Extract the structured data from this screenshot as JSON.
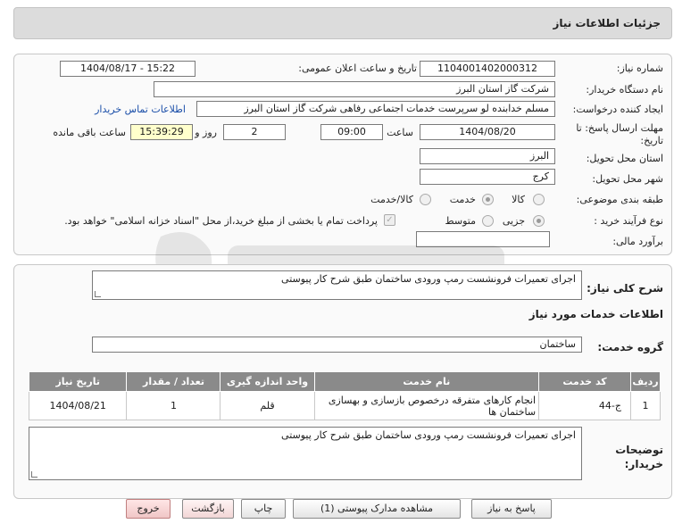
{
  "header": {
    "title": "جزئیات اطلاعات نیاز"
  },
  "form": {
    "need_number_label": "شماره نیاز:",
    "need_number": "1104001402000312",
    "announce_label": "تاریخ و ساعت اعلان عمومی:",
    "announce_value": "1404/08/17 - 15:22",
    "buyer_org_label": "نام دستگاه خریدار:",
    "buyer_org": "شرکت گاز استان البرز",
    "creator_label": "ایجاد کننده درخواست:",
    "creator": "مسلم خدابنده لو سرپرست خدمات اجتماعی رفاهی شرکت گاز استان البرز",
    "contact_link": "اطلاعات تماس خریدار",
    "deadline_label": "مهلت ارسال پاسخ: تا تاریخ:",
    "deadline_date": "1404/08/20",
    "time_label": "ساعت",
    "deadline_time": "09:00",
    "days_value": "2",
    "days_label": "روز و",
    "remaining_time": "15:39:29",
    "remaining_label": "ساعت باقی مانده",
    "province_label": "استان محل تحویل:",
    "province": "البرز",
    "city_label": "شهر محل تحویل:",
    "city": "کرج",
    "category_label": "طبقه بندی موضوعی:",
    "category_options": [
      "کالا",
      "خدمت",
      "کالا/خدمت"
    ],
    "category_selected": "خدمت",
    "process_label": "نوع فرآیند خرید :",
    "process_options": [
      "جزیی",
      "متوسط"
    ],
    "process_selected": "جزیی",
    "payment_note": "پرداخت تمام یا بخشی از مبلغ خرید،از محل \"اسناد خزانه اسلامی\" خواهد بود.",
    "budget_label": "برآورد مالی:",
    "budget_value": ""
  },
  "summary": {
    "label": "شرح کلی نیاز:",
    "text": "اجرای تعمیرات فرونشست رمپ ورودی ساختمان طبق شرح کار پیوستی"
  },
  "services": {
    "section_title": "اطلاعات خدمات مورد نیاز",
    "group_label": "گروه خدمت:",
    "group_value": "ساختمان",
    "columns": [
      "ردیف",
      "کد خدمت",
      "نام خدمت",
      "واحد اندازه گیری",
      "تعداد / مقدار",
      "تاریخ نیاز"
    ],
    "rows": [
      {
        "row": "1",
        "code": "ج-44",
        "name": "انجام کارهای متفرقه درخصوص بازسازی و بهسازی ساختمان ها",
        "unit": "قلم",
        "qty": "1",
        "date": "1404/08/21"
      }
    ]
  },
  "buyer_notes": {
    "label": "توضیحات خریدار:",
    "text": "اجرای تعمیرات فرونشست رمپ ورودی ساختمان طبق شرح کار پیوستی"
  },
  "buttons": {
    "reply": "پاسخ به نیاز",
    "attachments": "مشاهده مدارک پیوستی (1)",
    "print": "چاپ",
    "back": "بازگشت",
    "exit": "خروج"
  }
}
